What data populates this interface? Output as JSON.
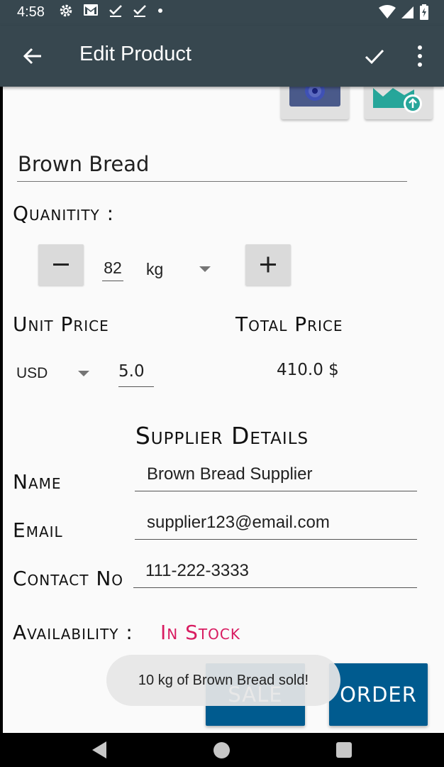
{
  "status_bar": {
    "time": "4:58",
    "left_icons": [
      "settings-icon",
      "gmail-icon",
      "task-done-icon",
      "task-done-icon",
      "dot-icon"
    ],
    "right_icons": [
      "wifi-icon",
      "signal-icon",
      "battery-charging-icon"
    ]
  },
  "app_bar": {
    "title": "Edit Product",
    "background": "#37474f"
  },
  "product": {
    "name": "Brown Bread"
  },
  "quantity": {
    "label": "Quanitity :",
    "value": "82",
    "unit": "kg"
  },
  "price": {
    "unit_price_label": "Unit Price",
    "total_price_label": "Total Price",
    "currency": "USD",
    "unit_price": "5.0",
    "total_price": "410.0  $"
  },
  "supplier": {
    "heading": "Supplier Details",
    "name_label": "Name",
    "name": "Brown Bread Supplier",
    "email_label": "Email",
    "email": "supplier123@email.com",
    "contact_label": "Contact No",
    "contact": "111-222-3333"
  },
  "availability": {
    "label": "Availability :",
    "value": "In Stock",
    "color": "#d81b60"
  },
  "actions": {
    "sale_label": "SALE",
    "order_label": "ORDER",
    "button_color": "#005b8f"
  },
  "toast": {
    "message": "10 kg of Brown Bread sold!"
  }
}
